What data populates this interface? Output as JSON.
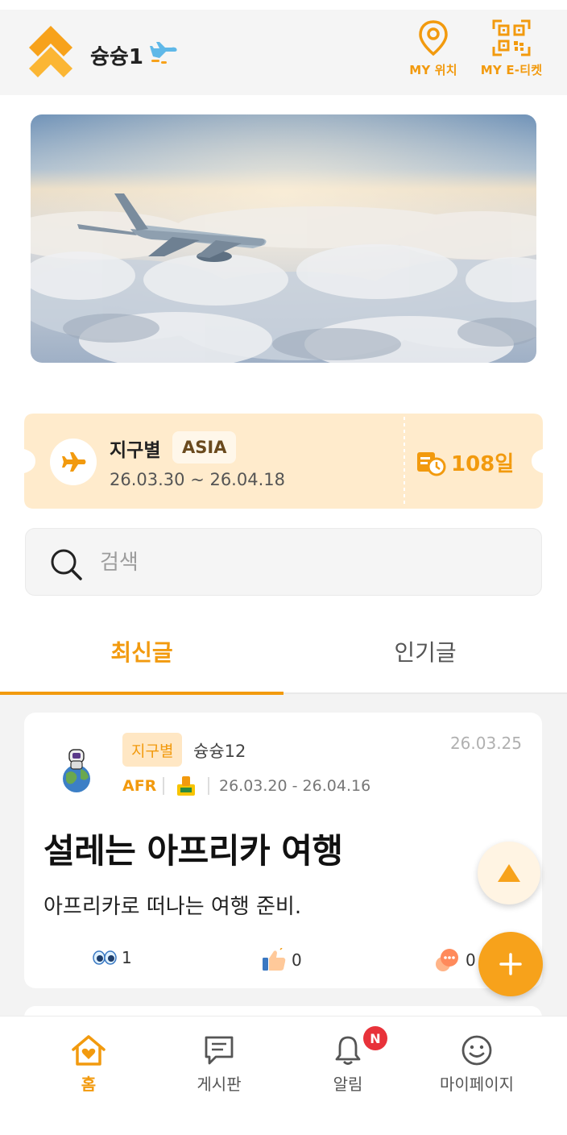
{
  "header": {
    "username": "슝슝1",
    "location_label": "MY 위치",
    "ticket_label": "MY E-티켓"
  },
  "trip": {
    "region": "지구별",
    "region_badge": "ASIA",
    "dates": "26.03.30 ~ 26.04.18",
    "dday": "108일"
  },
  "search": {
    "placeholder": "검색"
  },
  "tabs": {
    "latest": "최신글",
    "popular": "인기글"
  },
  "post": {
    "badge": "지구별",
    "author": "슝슝12",
    "date": "26.03.25",
    "region_code": "AFR",
    "period": "26.03.20 - 26.04.16",
    "title": "설레는 아프리카 여행",
    "body": "아프리카로 떠나는 여행 준비.",
    "views": "1",
    "likes": "0",
    "comments": "0"
  },
  "nav": {
    "home": "홈",
    "board": "게시판",
    "alarm": "알림",
    "alarm_badge": "N",
    "mypage": "마이페이지"
  },
  "colors": {
    "accent": "#f29a0e",
    "ticket_bg": "#ffebcc",
    "badge_red": "#e8323a"
  },
  "icons": [
    "logo-icon",
    "airplane-icon",
    "location-pin-icon",
    "qr-code-icon",
    "airplane-circle-icon",
    "calendar-clock-icon",
    "search-icon",
    "earth-avatar-icon",
    "flag-icon",
    "eyes-icon",
    "thumbs-up-icon",
    "chat-bubble-icon",
    "arrow-up-icon",
    "plus-icon",
    "home-heart-icon",
    "board-icon",
    "bell-icon",
    "smile-icon"
  ]
}
